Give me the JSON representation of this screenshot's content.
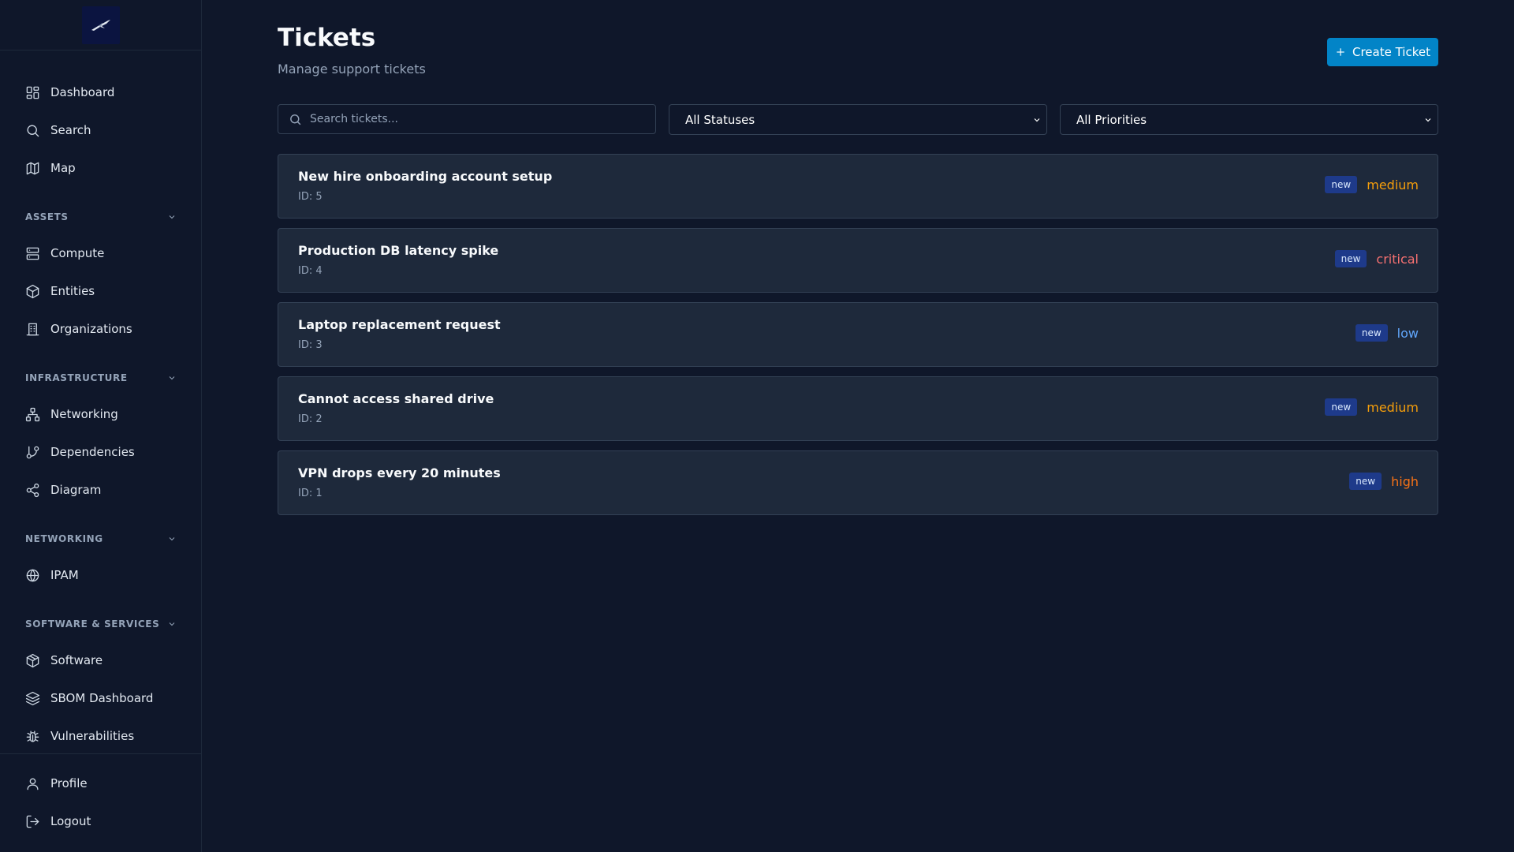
{
  "sidebar": {
    "nav_top": [
      {
        "label": "Dashboard",
        "icon": "dashboard-icon"
      },
      {
        "label": "Search",
        "icon": "search-icon"
      },
      {
        "label": "Map",
        "icon": "map-icon"
      }
    ],
    "sections": [
      {
        "title": "ASSETS",
        "items": [
          {
            "label": "Compute",
            "icon": "server-icon"
          },
          {
            "label": "Entities",
            "icon": "box-icon"
          },
          {
            "label": "Organizations",
            "icon": "building-icon"
          }
        ]
      },
      {
        "title": "INFRASTRUCTURE",
        "items": [
          {
            "label": "Networking",
            "icon": "network-icon"
          },
          {
            "label": "Dependencies",
            "icon": "git-branch-icon"
          },
          {
            "label": "Diagram",
            "icon": "share-icon"
          }
        ]
      },
      {
        "title": "NETWORKING",
        "items": [
          {
            "label": "IPAM",
            "icon": "globe-icon"
          }
        ]
      },
      {
        "title": "SOFTWARE & SERVICES",
        "items": [
          {
            "label": "Software",
            "icon": "package-icon"
          },
          {
            "label": "SBOM Dashboard",
            "icon": "layers-icon"
          },
          {
            "label": "Vulnerabilities",
            "icon": "bug-icon"
          }
        ]
      }
    ],
    "bottom": [
      {
        "label": "Profile",
        "icon": "user-icon"
      },
      {
        "label": "Logout",
        "icon": "logout-icon"
      }
    ]
  },
  "header": {
    "title": "Tickets",
    "subtitle": "Manage support tickets",
    "create_label": "Create Ticket"
  },
  "filters": {
    "search_placeholder": "Search tickets...",
    "status_selected": "All Statuses",
    "priority_selected": "All Priorities"
  },
  "tickets": [
    {
      "title": "New hire onboarding account setup",
      "id": "ID: 5",
      "status": "new",
      "priority": "medium"
    },
    {
      "title": "Production DB latency spike",
      "id": "ID: 4",
      "status": "new",
      "priority": "critical"
    },
    {
      "title": "Laptop replacement request",
      "id": "ID: 3",
      "status": "new",
      "priority": "low"
    },
    {
      "title": "Cannot access shared drive",
      "id": "ID: 2",
      "status": "new",
      "priority": "medium"
    },
    {
      "title": "VPN drops every 20 minutes",
      "id": "ID: 1",
      "status": "new",
      "priority": "high"
    }
  ],
  "colors": {
    "accent": "#0284c7",
    "priority_medium": "#f59e0b",
    "priority_critical": "#f87171",
    "priority_low": "#60a5fa",
    "priority_high": "#f97316",
    "status_badge": "#1e3a8a"
  }
}
